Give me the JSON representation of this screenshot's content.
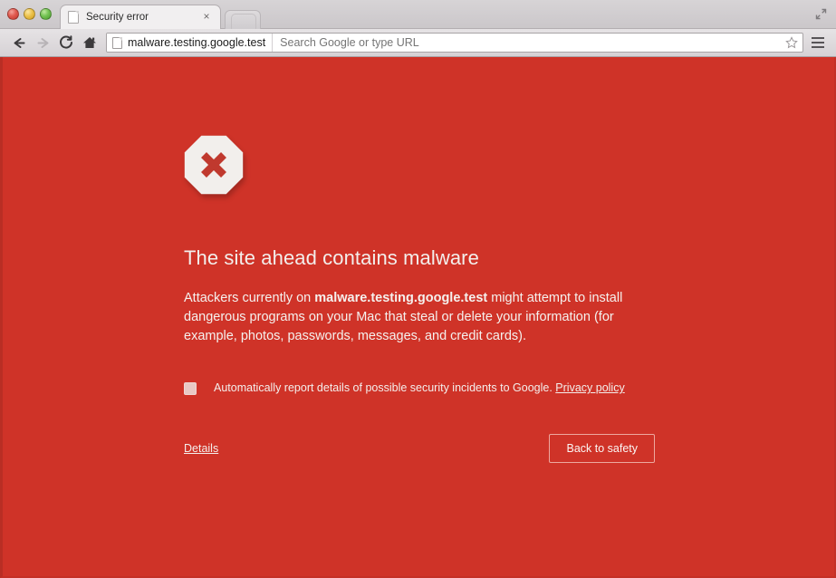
{
  "window": {
    "traffic_lights": [
      "close",
      "minimize",
      "zoom"
    ],
    "fullscreen_label": "Enter full screen"
  },
  "tabstrip": {
    "tabs": [
      {
        "title": "Security error",
        "favicon": "page-icon",
        "close_label": "×"
      }
    ],
    "new_tab_label": "New tab"
  },
  "toolbar": {
    "back_label": "Back",
    "forward_label": "Forward",
    "reload_label": "Reload",
    "home_label": "Home",
    "menu_label": "Customize and control Google Chrome",
    "omnibox": {
      "site": "malware.testing.google.test",
      "placeholder": "Search Google or type URL",
      "value": "",
      "bookmark_label": "Bookmark this page"
    }
  },
  "interstitial": {
    "icon": "octagon-error-icon",
    "title": "The site ahead contains malware",
    "body_prefix": "Attackers currently on ",
    "body_site": "malware.testing.google.test",
    "body_suffix": " might attempt to install dangerous programs on your Mac that steal or delete your information (for example, photos, passwords, messages, and credit cards).",
    "optin": {
      "checked": false,
      "label": "Automatically report details of possible security incidents to Google.",
      "privacy_link": "Privacy policy"
    },
    "details_link": "Details",
    "primary_button": "Back to safety"
  },
  "colors": {
    "background": "#cf3328",
    "text": "#f4efec",
    "button_border": "#eda89f",
    "icon_white": "#f3f0ed",
    "icon_x": "#c0392e"
  }
}
